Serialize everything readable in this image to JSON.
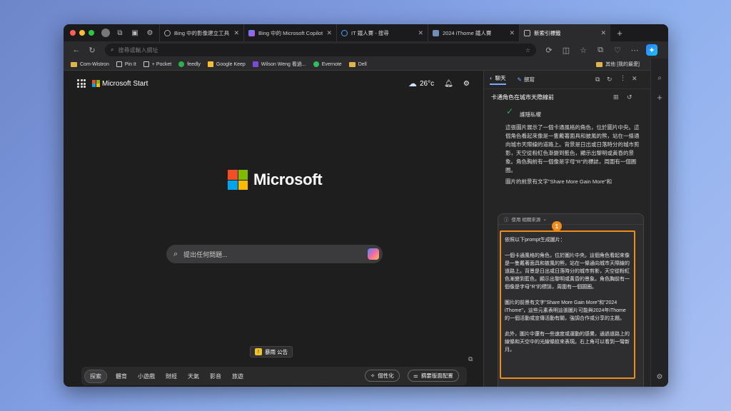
{
  "tabs": [
    {
      "label": "Bing 中的影像建立工具",
      "color": "#3a7bd5"
    },
    {
      "label": "Bing 中的 Microsoft Copilot",
      "color": "#c152d6"
    },
    {
      "label": "IT 鐵人賽 - 搜尋",
      "color": "#4aa3ff"
    },
    {
      "label": "2024 iThome 鐵人賽",
      "color": "#6f8fb8"
    },
    {
      "label": "新索引標籤",
      "color": "#8a8a8a"
    }
  ],
  "address": {
    "placeholder": "搜尋或輸入網址"
  },
  "bookmarks": [
    {
      "label": "Com-Wistron",
      "type": "folder"
    },
    {
      "label": "Pin It",
      "type": "page"
    },
    {
      "label": "+ Pocket",
      "type": "page"
    },
    {
      "label": "feedly",
      "type": "icon",
      "color": "#2bb24c"
    },
    {
      "label": "Google Keep",
      "type": "icon",
      "color": "#f6bf26"
    },
    {
      "label": "Wilson Weng 看過...",
      "type": "icon",
      "color": "#7b4ad6"
    },
    {
      "label": "Evernote",
      "type": "icon",
      "color": "#2dbe60"
    },
    {
      "label": "Dell",
      "type": "folder"
    }
  ],
  "other_favorites": "其他 [我的最愛]",
  "main": {
    "brand": "Microsoft Start",
    "temperature": "26°c",
    "big_title": "Microsoft",
    "search_placeholder": "提出任何問題...",
    "alert": "暴雨 公告",
    "nav": [
      "探索",
      "體育",
      "小遊戲",
      "財經",
      "天氣",
      "影音",
      "旅遊"
    ],
    "personalize": "個性化",
    "layout": "摘要版面配置"
  },
  "sidebar": {
    "tab_chat": "聊天",
    "tab_compose": "撰寫",
    "conversation_title": "卡通角色在城市天際線前",
    "privacy": "護隱私權",
    "body1": "這張圖片展示了一個卡通風格的角色，位於圖片中央。這個角色看起來像是一隻戴著面具和披風的熊，站在一條通向城市天際線的道路上。背景是日出或日落時分的城市剪影，天空從粉紅色漸變到藍色，顯示出黎明或黃昏的景象。角色胸前有一個像是字母\"R\"的標誌，周圍有一個圓圈。",
    "body2": "圖片的前景有文字\"Share More Gain More\"和",
    "source_label": "使用 相關來源",
    "prompt_text": "依照以下prompt生成圖片：\n\n一個卡通風格的角色，位於圖片中央。這個角色看起來像是一隻戴著面具和披風的熊，站在一條通向城市天際線的道路上。背景是日出或日落時分的城市剪影，天空從粉紅色漸變到藍色，顯示出黎明或黃昏的景象。角色胸前有一個像是字母\"R\"的標誌，周圍有一個圓圈。\n\n圖片的前景有文字\"Share More Gain More\"和\"2024 iThome\"，這些元素表明這張圖片可能與2024年iThome的一個活動或宣傳活動有關，強調合作或分享的主題。\n\n此外，圖片中還有一些速度或運動的感覺，通過道路上的線條和天空中的光線條紋來表現。右上角可以看到一彎新月。",
    "badge1": "1",
    "badge2": "2"
  },
  "colors": {
    "accent": "#f08c1a",
    "ms_red": "#f25022",
    "ms_green": "#7fba00",
    "ms_blue": "#00a4ef",
    "ms_yellow": "#ffb900"
  }
}
